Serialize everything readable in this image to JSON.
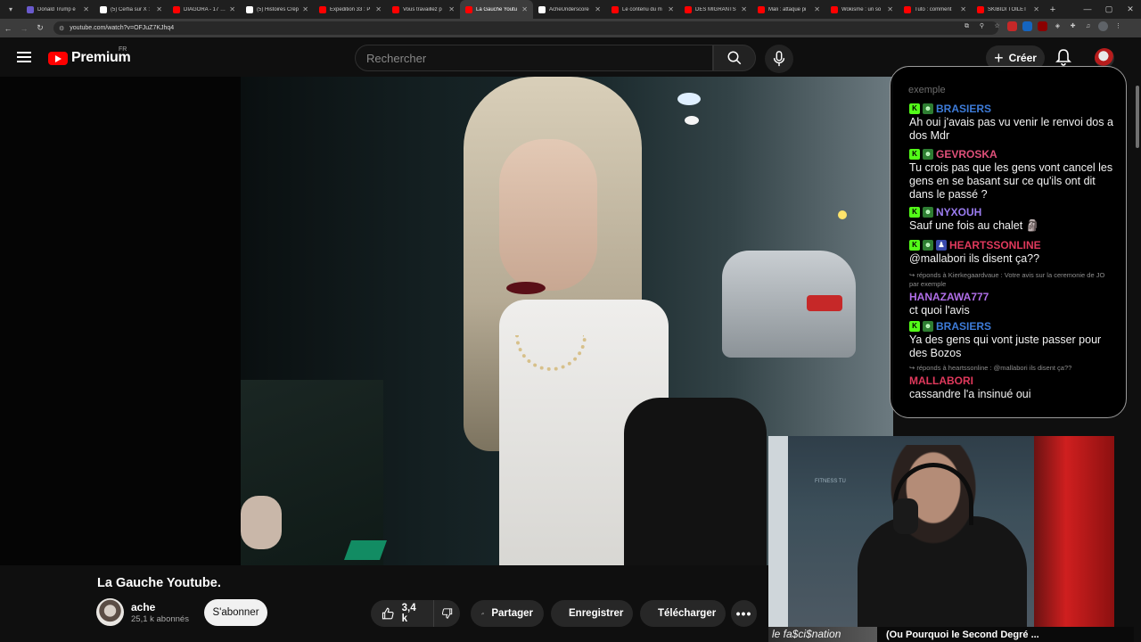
{
  "browser": {
    "tabs": [
      {
        "label": "Donald Trump é",
        "color": "#6a5acd"
      },
      {
        "label": "(5) Cerfia sur X :",
        "color": "#ffffff"
      },
      {
        "label": "DIAGORA - 17 au",
        "color": "#ff0000"
      },
      {
        "label": "(5) Histoires Crép",
        "color": "#ffffff"
      },
      {
        "label": "Expedition 33 : P",
        "color": "#ff0000"
      },
      {
        "label": "Vous travaillez p",
        "color": "#ff0000"
      },
      {
        "label": "La Gauche Youtu",
        "color": "#ff0000"
      },
      {
        "label": "AcheUnderscore",
        "color": "#ffffff"
      },
      {
        "label": "Le contenu du m",
        "color": "#ff0000"
      },
      {
        "label": "DES MIGRANTS",
        "color": "#ff0000"
      },
      {
        "label": "Mali : attaque pi",
        "color": "#ff0000"
      },
      {
        "label": "Wokisme : un so",
        "color": "#ff0000"
      },
      {
        "label": "Tuto : comment",
        "color": "#ff0000"
      },
      {
        "label": "SKIBIDI TOILET",
        "color": "#ff0000"
      }
    ],
    "active_tab_index": 6,
    "url": "youtube.com/watch?v=OFJuZ7KJhq4"
  },
  "youtube": {
    "logo_text": "Premium",
    "country_code": "FR",
    "search_placeholder": "Rechercher",
    "create_label": "Créer"
  },
  "video": {
    "title": "La Gauche Youtube.",
    "channel_name": "ache",
    "subscribers": "25,1 k abonnés",
    "subscribe_label": "S'abonner",
    "likes": "3,4 k",
    "share_label": "Partager",
    "save_label": "Enregistrer",
    "download_label": "Télécharger"
  },
  "chat": {
    "cut_text": "exemple",
    "messages": [
      {
        "user": "BRASIERS",
        "color": "#3d7bd8",
        "badges": [
          "k",
          "g"
        ],
        "text": "Ah oui j'avais pas vu venir le renvoi dos a dos Mdr",
        "reply": ""
      },
      {
        "user": "GEVROSKA",
        "color": "#e0507a",
        "badges": [
          "k",
          "g"
        ],
        "text": "Tu crois pas que les gens vont cancel les gens en se basant sur ce qu'ils ont dit dans le passé ?",
        "reply": ""
      },
      {
        "user": "NYXOUH",
        "color": "#9b7cf0",
        "badges": [
          "k",
          "g"
        ],
        "text": "Sauf une fois au chalet 🗿",
        "reply": ""
      },
      {
        "user": "HEARTSSONLINE",
        "color": "#e0395c",
        "badges": [
          "k",
          "g",
          "b"
        ],
        "text": "@mallabori ils disent ça??",
        "reply": ""
      },
      {
        "user": "HANAZAWA777",
        "color": "#b06ee8",
        "badges": [],
        "text": "ct quoi l'avis",
        "reply": "↪ réponds à Kierkegaardvaue : Votre avis sur la ceremonie de JO par exemple"
      },
      {
        "user": "BRASIERS",
        "color": "#3d7bd8",
        "badges": [
          "k",
          "g"
        ],
        "text": "Ya des gens qui vont juste passer pour des Bozos",
        "reply": ""
      },
      {
        "user": "MALLABORI",
        "color": "#e0395c",
        "badges": [],
        "text": "cassandre l'a insinué oui",
        "reply": "↪ réponds à heartssonline : @mallabori ils disent ça??"
      }
    ]
  },
  "stream": {
    "ticker_logo": "le fa$ci$nation",
    "ticker_text": "(Ou Pourquoi le Second Degré ...",
    "cam_sign": "FITNESS TU"
  }
}
